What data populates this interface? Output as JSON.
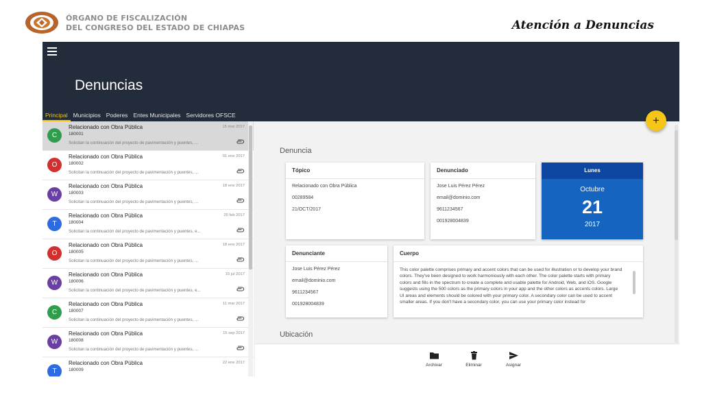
{
  "header": {
    "org_line1": "ÓRGANO DE FISCALIZACIÓN",
    "org_line2": "DEL CONGRESO DEL ESTADO DE CHIAPAS",
    "slide_title": "Atención a Denuncias"
  },
  "app": {
    "title": "Denuncias",
    "tabs": [
      {
        "label": "Principal",
        "active": true
      },
      {
        "label": "Municipios"
      },
      {
        "label": "Poderes"
      },
      {
        "label": "Entes Municipales"
      },
      {
        "label": "Servidores OFSCE"
      }
    ],
    "fab_label": "+"
  },
  "list": {
    "items": [
      {
        "letter": "C",
        "color": "#2e9d4e",
        "title": "Relacionado con Obra Pública",
        "id": "180001",
        "date": "15 mar 2017",
        "snippet": "Solicitan la continuación del proyecto de pavimentación y puentes, ...",
        "selected": true
      },
      {
        "letter": "O",
        "color": "#d32f2f",
        "title": "Relacionado con Obra Pública",
        "id": "180002",
        "date": "01 ene 2017",
        "snippet": "Solicitan la continuación del proyecto de pavimentación y puentes, ..."
      },
      {
        "letter": "W",
        "color": "#6a3fa3",
        "title": "Relacionado con Obra Pública",
        "id": "180003",
        "date": "18 ene 2017",
        "snippet": "Solicitan la continuación del proyecto de pavimentación y puentes, ..."
      },
      {
        "letter": "T",
        "color": "#2d6be0",
        "title": "Relacionado con Obra Pública",
        "id": "180004",
        "date": "25 feb 2017",
        "snippet": "Solicitan la continuación del proyecto de pavimentación y puentes, e..."
      },
      {
        "letter": "O",
        "color": "#d32f2f",
        "title": "Relacionado con Obra Pública",
        "id": "180005",
        "date": "18 ene 2017",
        "snippet": "Solicitan la continuación del proyecto de pavimentación y puentes, ..."
      },
      {
        "letter": "W",
        "color": "#6a3fa3",
        "title": "Relacionado con Obra Pública",
        "id": "180006",
        "date": "15 jul 2017",
        "snippet": "Solicitan la continuación del proyecto de pavimentación y puentes, e..."
      },
      {
        "letter": "C",
        "color": "#2e9d4e",
        "title": "Relacionado con Obra Pública",
        "id": "180007",
        "date": "11 mar 2017",
        "snippet": "Solicitan la continuación del proyecto de pavimentación y puentes, ..."
      },
      {
        "letter": "W",
        "color": "#6a3fa3",
        "title": "Relacionado con Obra Pública",
        "id": "180008",
        "date": "15 sep 2017",
        "snippet": "Solicitan la continuación del proyecto de pavimentación y puentes, ..."
      },
      {
        "letter": "T",
        "color": "#2d6be0",
        "title": "Relacionado con Obra Pública",
        "id": "180009",
        "date": "22 ene 2017",
        "snippet": ""
      }
    ]
  },
  "detail": {
    "section_denuncia": "Denuncia",
    "section_ubicacion": "Ubicación",
    "topico": {
      "title": "Tópico",
      "fields": [
        "Relacionado con Obra Pública",
        "00289584",
        "21/OCT/2017"
      ]
    },
    "denunciado": {
      "title": "Denunciado",
      "fields": [
        "Jose Luis Pérez Pérez",
        "email@dominio.com",
        "9611234567",
        "001928004839"
      ]
    },
    "calendar": {
      "weekday": "Lunes",
      "month": "Octubre",
      "day": "21",
      "year": "2017"
    },
    "denunciante": {
      "title": "Denunciante",
      "fields": [
        "Jose Luis Pérez Pérez",
        "email@dominio.com",
        "9611234567",
        "001928004839"
      ]
    },
    "cuerpo": {
      "title": "Cuerpo",
      "text": "This color palette comprises primary and accent colors that can be used for illustration or to develop your brand colors. They've been designed to work harmoniously with each other. The color palette starts with primary colors and fills in the spectrum to create a complete and usable palette for Android, Web, and iOS. Google suggests using the 500 colors as the primary colors in your app and the other colors as accents colors. Large UI areas and elements should be colored with your primary color. A secondary color can be used to accent smaller areas. If you don't have a secondary color, you can use your primary color instead for"
    }
  },
  "toolbar": {
    "archivar": "Archivar",
    "eliminar": "Eliminar",
    "asignar": "Asignar"
  }
}
